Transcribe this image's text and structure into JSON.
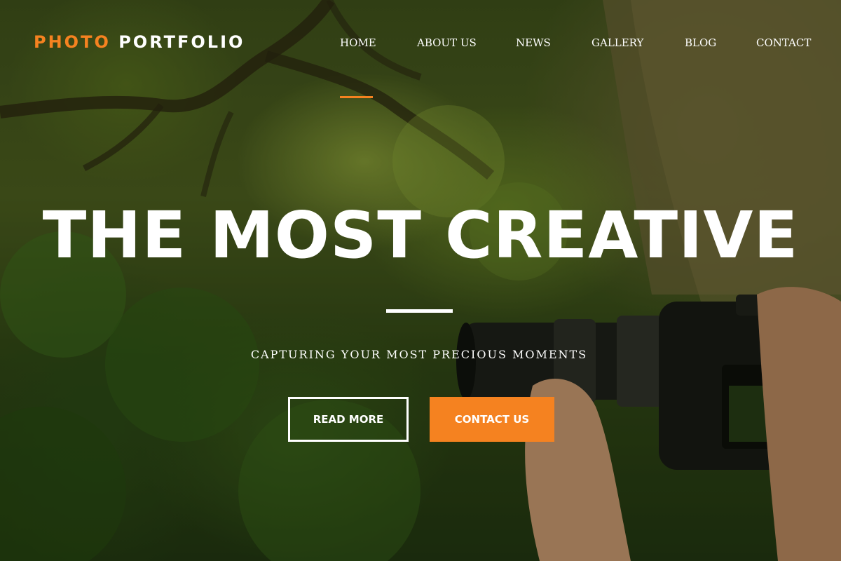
{
  "brand": {
    "logo_part1": "PHOTO",
    "logo_part2": "PORTFOLIO",
    "accent_color": "#f58220"
  },
  "nav": {
    "items": [
      {
        "label": "HOME",
        "active": true
      },
      {
        "label": "ABOUT US",
        "active": false
      },
      {
        "label": "NEWS",
        "active": false
      },
      {
        "label": "GALLERY",
        "active": false
      },
      {
        "label": "BLOG",
        "active": false
      },
      {
        "label": "CONTACT",
        "active": false
      }
    ]
  },
  "hero": {
    "headline": "THE MOST CREATIVE",
    "tagline": "CAPTURING YOUR MOST PRECIOUS MOMENTS",
    "background": "forest-with-camera-photo"
  },
  "buttons": {
    "read_more": "READ MORE",
    "contact_us": "CONTACT US"
  }
}
